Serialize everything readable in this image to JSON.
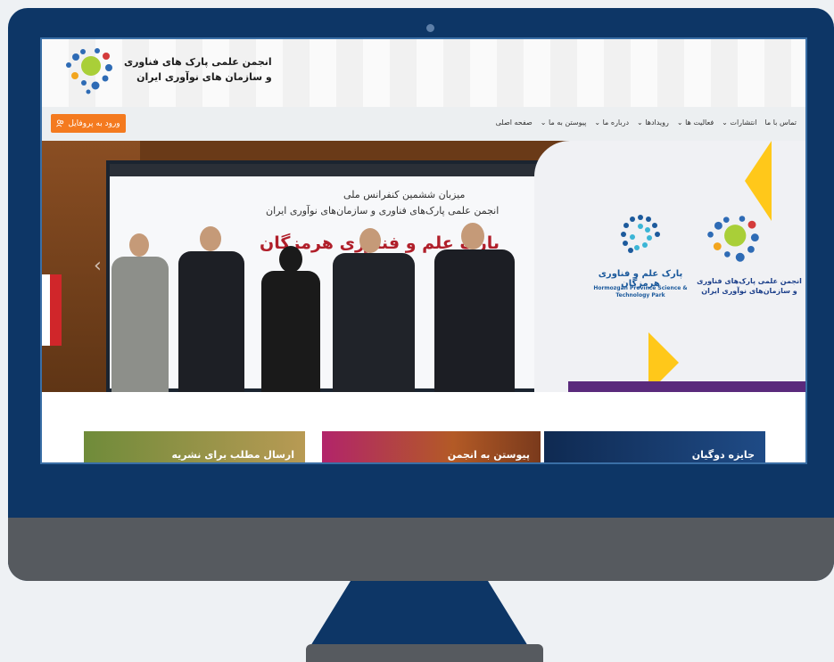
{
  "org": {
    "name_line1": "انجمن علمی پارک های فناوری",
    "name_line2": "و سازمان های نوآوری ایران"
  },
  "nav": {
    "profile_button": "ورود به پروفایل",
    "items": [
      {
        "label": "صفحه اصلی",
        "chevron": ""
      },
      {
        "label": "پیوستن به ما",
        "chevron": "⌄"
      },
      {
        "label": "درباره ما",
        "chevron": "⌄"
      },
      {
        "label": "رویدادها",
        "chevron": "⌄"
      },
      {
        "label": "فعالیت ها",
        "chevron": "⌄"
      },
      {
        "label": "انتشارات",
        "chevron": "⌄"
      },
      {
        "label": "تماس با ما",
        "chevron": ""
      }
    ]
  },
  "slide": {
    "line1": "میزبان ششمین کنفرانس ملی",
    "line2": "انجمن علمی پارک‌های فناوری و سازمان‌های نوآوری ایران",
    "park_title": "پارک علم و فناوری هرمزگان",
    "park_logo_name": "پارک علم و فناوری هرمزگان",
    "park_logo_en": "Hormozgan Province Science & Technology Park",
    "assoc_logo_name": "انجمن علمی پارک‌های فناوری و سازمان‌های نوآوری ایران",
    "prev_arrow": "‹"
  },
  "cards": [
    {
      "label": "جایزه دوگیان"
    },
    {
      "label": "پیوستن به انجمن"
    },
    {
      "label": "ارسال مطلب برای نشریه"
    }
  ],
  "colors": {
    "frame": "#0d3666",
    "accent_orange": "#f47a1f",
    "accent_yellow": "#ffc81a",
    "deep_purple": "#5a2a7c"
  }
}
